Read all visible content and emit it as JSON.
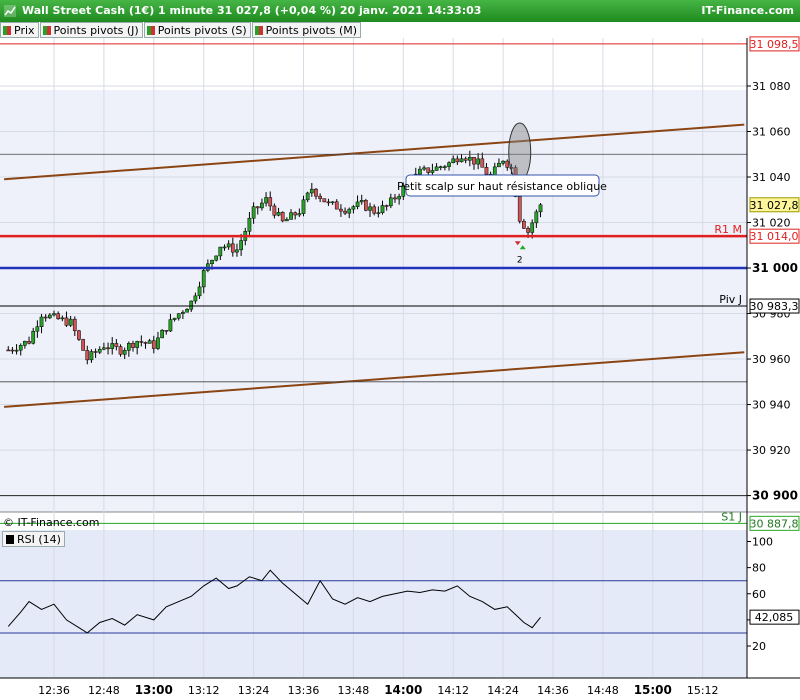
{
  "header": {
    "title": "Wall Street Cash (1€) 1 minute 31 027,8 (+0,04 %) 20 janv. 2021 14:33:03",
    "brand": "IT-Finance.com"
  },
  "legend": [
    "Prix",
    "Points pivots (J)",
    "Points pivots (S)",
    "Points pivots (M)"
  ],
  "copyright": "© IT-Finance.com",
  "rsi_label": "RSI (14)",
  "annotation": "Petit scalp sur haut résistance oblique",
  "marker_count": "2",
  "price_badges": {
    "top": "31 098,5",
    "current": "31 027,8",
    "r1m": "31 014,0",
    "pivj": "30 983,3",
    "s1j": "30 887,8",
    "rsi": "42,085"
  },
  "level_labels": {
    "r1m": "R1 M",
    "pivj": "Piv J",
    "s1j": "S1 J"
  },
  "colors": {
    "up": "#27a127",
    "down": "#d25555",
    "r1": "#e02020",
    "pivot_m": "#2233bb",
    "trend": "#8b4513"
  },
  "chart_data": [
    {
      "type": "candlestick",
      "title": "Wall Street Cash (1€) 1 minute",
      "x_labels": [
        "12:36",
        "12:48",
        "13:00",
        "13:12",
        "13:24",
        "13:36",
        "13:48",
        "14:00",
        "14:12",
        "14:24",
        "14:36",
        "14:48",
        "15:00",
        "15:12"
      ],
      "x_label_bold": [
        "13:00",
        "14:00",
        "15:00"
      ],
      "y_ticks": [
        31080,
        31060,
        31040,
        31020,
        31000,
        30980,
        30960,
        30940,
        30920,
        30900
      ],
      "y_ticks_bold": [
        31000,
        30900
      ],
      "y_tick_labels": [
        "31 080",
        "31 060",
        "31 040",
        "31 020",
        "31 000",
        "30 980",
        "30 960",
        "30 940",
        "30 920",
        "30 900"
      ],
      "ylim": [
        30880,
        31105
      ],
      "levels": [
        {
          "name": "top",
          "value": 31098.5,
          "color": "#e02020"
        },
        {
          "name": "R1 M",
          "value": 31014.0,
          "color": "#e02020"
        },
        {
          "name": "pivot M",
          "value": 31000.0,
          "color": "#2233bb"
        },
        {
          "name": "Piv J",
          "value": 30983.3,
          "color": "#000000"
        },
        {
          "name": "S1 J",
          "value": 30887.8,
          "color": "#22aa22"
        }
      ],
      "trendlines": [
        {
          "from": [
            "12:24",
            31039
          ],
          "to": [
            "15:22",
            31063
          ]
        },
        {
          "from": [
            "12:24",
            30939
          ],
          "to": [
            "15:22",
            30963
          ]
        }
      ],
      "close_path": [
        [
          "12:25",
          30964
        ],
        [
          "12:30",
          30968
        ],
        [
          "12:33",
          30980
        ],
        [
          "12:36",
          30978
        ],
        [
          "12:40",
          30976
        ],
        [
          "12:44",
          30960
        ],
        [
          "12:48",
          30966
        ],
        [
          "12:52",
          30964
        ],
        [
          "12:56",
          30968
        ],
        [
          "13:00",
          30966
        ],
        [
          "13:03",
          30974
        ],
        [
          "13:06",
          30980
        ],
        [
          "13:09",
          30985
        ],
        [
          "13:12",
          30998
        ],
        [
          "13:16",
          31010
        ],
        [
          "13:20",
          31008
        ],
        [
          "13:24",
          31025
        ],
        [
          "13:27",
          31030
        ],
        [
          "13:31",
          31020
        ],
        [
          "13:35",
          31025
        ],
        [
          "13:38",
          31035
        ],
        [
          "13:42",
          31028
        ],
        [
          "13:46",
          31026
        ],
        [
          "13:50",
          31028
        ],
        [
          "13:53",
          31025
        ],
        [
          "13:56",
          31027
        ],
        [
          "14:00",
          31035
        ],
        [
          "14:04",
          31042
        ],
        [
          "14:08",
          31044
        ],
        [
          "14:11",
          31046
        ],
        [
          "14:14",
          31050
        ],
        [
          "14:18",
          31046
        ],
        [
          "14:21",
          31040
        ],
        [
          "14:24",
          31048
        ],
        [
          "14:26",
          31044
        ],
        [
          "14:28",
          31022
        ],
        [
          "14:30",
          31016
        ],
        [
          "14:32",
          31024
        ],
        [
          "14:33",
          31027.8
        ]
      ],
      "highlight": {
        "time": "14:28",
        "low": 31040,
        "high": 31062
      },
      "marker": {
        "time": "14:28",
        "value": 31010
      }
    },
    {
      "type": "line",
      "title": "RSI (14)",
      "y_ticks": [
        100,
        80,
        60,
        40,
        20
      ],
      "ylim": [
        0,
        110
      ],
      "bands": [
        70,
        30
      ],
      "values": [
        [
          "12:25",
          35
        ],
        [
          "12:28",
          46
        ],
        [
          "12:30",
          54
        ],
        [
          "12:33",
          48
        ],
        [
          "12:36",
          52
        ],
        [
          "12:39",
          40
        ],
        [
          "12:42",
          34
        ],
        [
          "12:44",
          30
        ],
        [
          "12:47",
          38
        ],
        [
          "12:50",
          41
        ],
        [
          "12:53",
          36
        ],
        [
          "12:56",
          44
        ],
        [
          "13:00",
          40
        ],
        [
          "13:03",
          50
        ],
        [
          "13:06",
          54
        ],
        [
          "13:09",
          58
        ],
        [
          "13:12",
          66
        ],
        [
          "13:15",
          72
        ],
        [
          "13:18",
          64
        ],
        [
          "13:20",
          66
        ],
        [
          "13:23",
          73
        ],
        [
          "13:26",
          70
        ],
        [
          "13:28",
          78
        ],
        [
          "13:31",
          68
        ],
        [
          "13:34",
          60
        ],
        [
          "13:37",
          52
        ],
        [
          "13:40",
          70
        ],
        [
          "13:43",
          56
        ],
        [
          "13:46",
          52
        ],
        [
          "13:49",
          57
        ],
        [
          "13:52",
          54
        ],
        [
          "13:55",
          58
        ],
        [
          "13:58",
          60
        ],
        [
          "14:01",
          62
        ],
        [
          "14:04",
          61
        ],
        [
          "14:07",
          63
        ],
        [
          "14:10",
          62
        ],
        [
          "14:13",
          66
        ],
        [
          "14:16",
          58
        ],
        [
          "14:19",
          54
        ],
        [
          "14:22",
          48
        ],
        [
          "14:25",
          50
        ],
        [
          "14:27",
          44
        ],
        [
          "14:29",
          38
        ],
        [
          "14:31",
          34
        ],
        [
          "14:33",
          42
        ]
      ]
    }
  ]
}
